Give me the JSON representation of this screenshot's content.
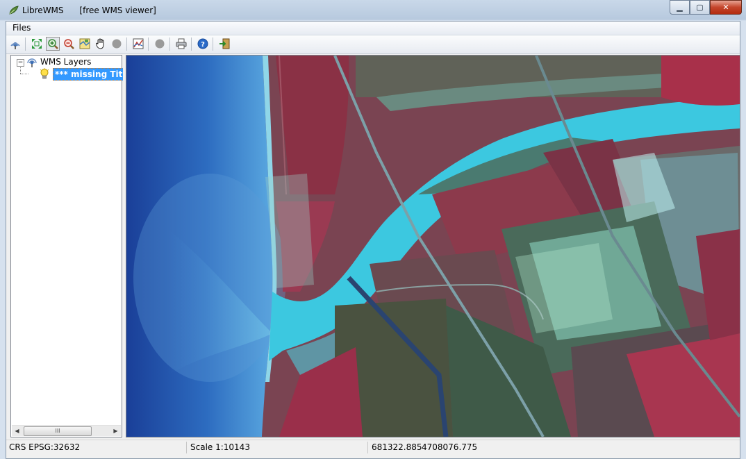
{
  "window": {
    "app_name": "LibreWMS",
    "subtitle": "[free WMS viewer]",
    "min_label": "▁",
    "max_label": "▢",
    "close_label": "✕"
  },
  "menu": {
    "files": "Files"
  },
  "toolbar": {
    "icons": [
      "wms-connect-icon",
      "zoom-full-extent-icon",
      "zoom-in-icon",
      "zoom-out-icon",
      "zoom-layer-icon",
      "pan-hand-icon",
      "disabled-gray-icon",
      "layer-properties-icon",
      "disabled-gray-icon",
      "print-icon",
      "help-icon",
      "exit-icon"
    ],
    "active": "zoom-in-icon"
  },
  "tree": {
    "expander": "−",
    "root_label": "WMS Layers",
    "child_label": "*** missing Title"
  },
  "scrollbar": {
    "left": "◀",
    "right": "▶",
    "grip": "III"
  },
  "status": {
    "crs": "CRS EPSG:32632",
    "scale": "Scale 1:10143",
    "x": "681322.885",
    "y": "4708076.775"
  },
  "colors": {
    "selection": "#3399ff",
    "sea": "#1e4fa8",
    "river": "#3cc8e0",
    "vegetation": "#a33a52"
  }
}
